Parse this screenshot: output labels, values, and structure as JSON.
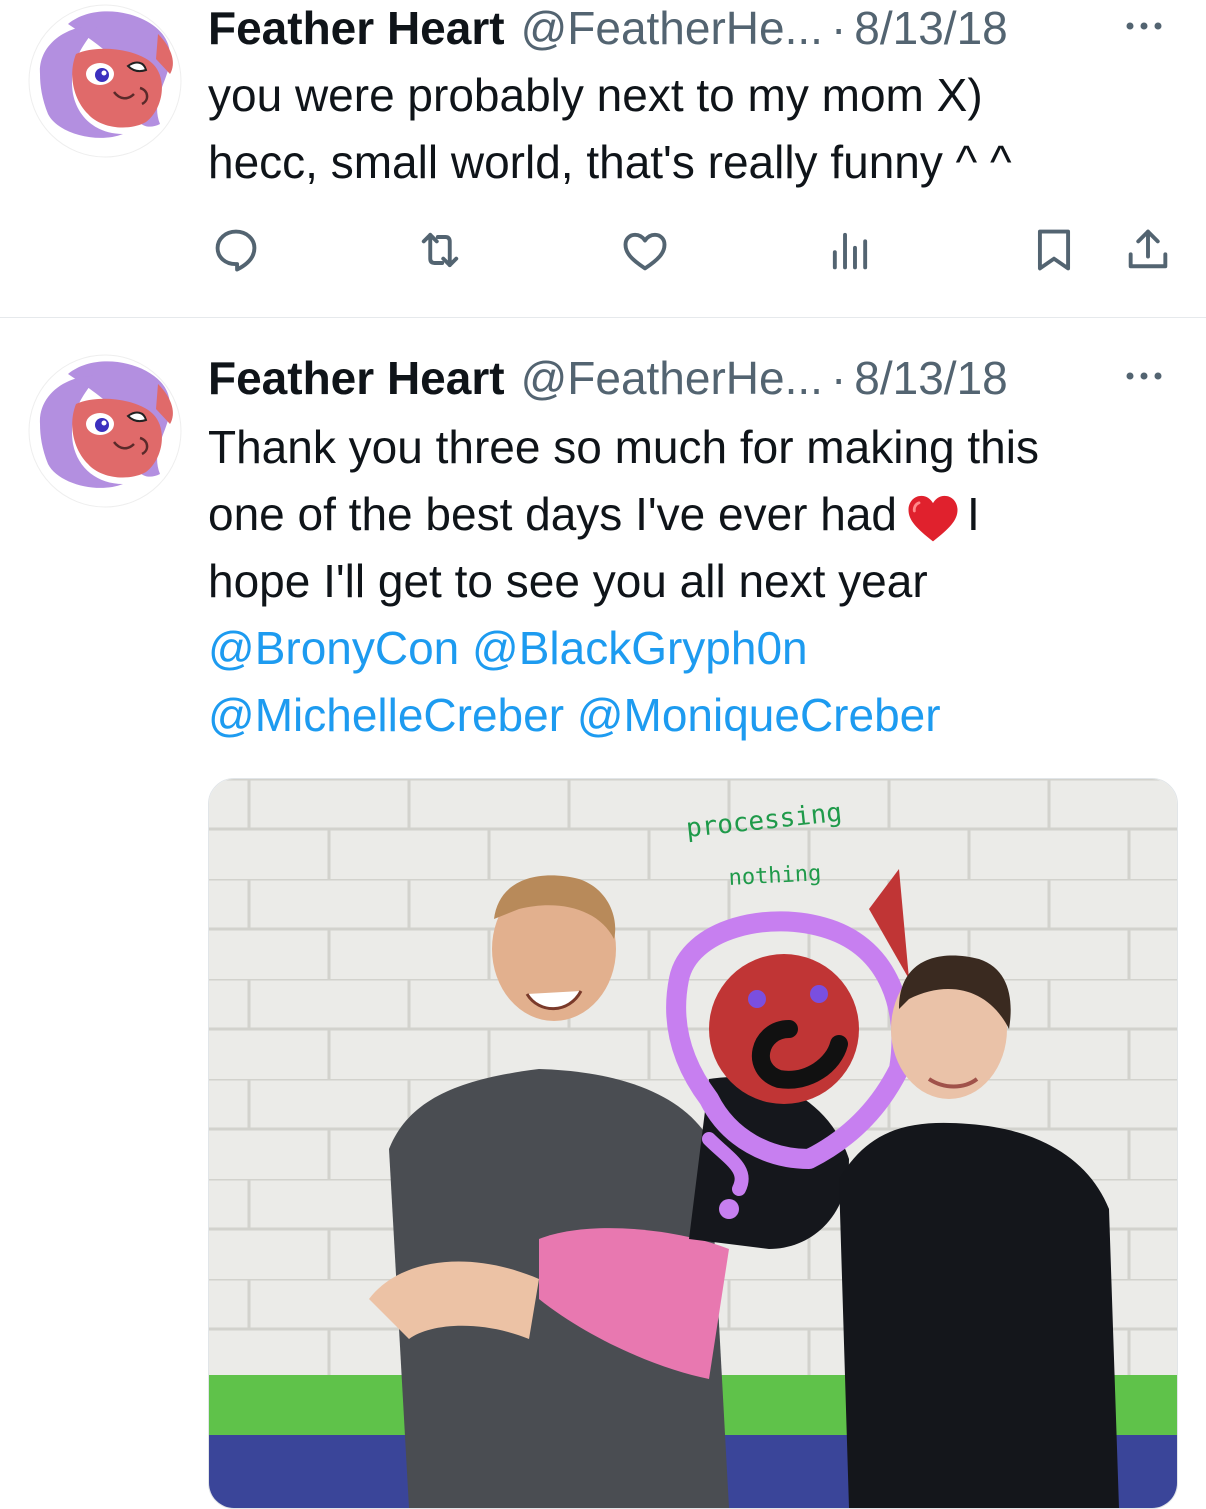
{
  "tweets": [
    {
      "author_name": "Feather Heart",
      "author_handle": "@FeatherHe...",
      "separator": "·",
      "date": "8/13/18",
      "text_lines": [
        "you were probably next to my mom X)",
        "hecc, small world, that's really funny ^ ^"
      ],
      "actions": [
        "reply-icon",
        "retweet-icon",
        "like-icon",
        "views-icon",
        "bookmark-icon",
        "share-icon"
      ]
    },
    {
      "author_name": "Feather Heart",
      "author_handle": "@FeatherHe...",
      "separator": "·",
      "date": "8/13/18",
      "text_line1": "Thank you three so much for making this",
      "text_line2_a": "one of the best days I've ever had",
      "text_line2_b": "I",
      "text_line3": "hope I'll get to see you all next year",
      "mentions": [
        "@BronyCon",
        "@BlackGryph0n",
        "@MichelleCreber",
        "@MoniqueCreber"
      ],
      "media": {
        "type": "photo",
        "scribble_line1": "processing",
        "scribble_line2": "nothing"
      }
    }
  ],
  "colors": {
    "link": "#1d9bf0",
    "secondary_text": "#536471",
    "heart": "#e0212d",
    "scribble_purple": "#c77ff0",
    "scribble_red": "#c03535",
    "scribble_green": "#1f9a4a"
  }
}
